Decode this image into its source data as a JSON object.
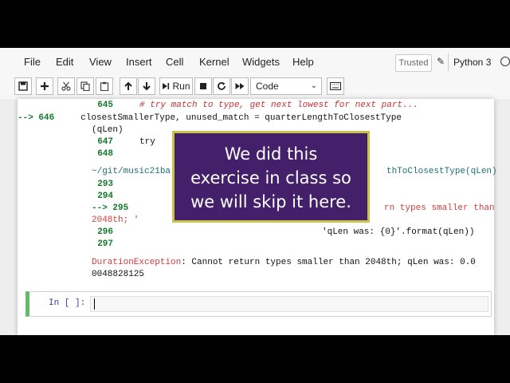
{
  "menu": {
    "items": [
      "File",
      "Edit",
      "View",
      "Insert",
      "Cell",
      "Kernel",
      "Widgets",
      "Help"
    ],
    "trusted": "Trusted",
    "kernel_name": "Python 3"
  },
  "toolbar": {
    "run_label": "Run",
    "cell_type": "Code"
  },
  "traceback": [
    {
      "num": "645",
      "marker": "",
      "code": "# try match to type, get next lowest for next part..."
    },
    {
      "num": "646",
      "marker": "-->",
      "code": "closestSmallerType, unused_match = quarterLengthToClosestType"
    },
    {
      "cont": "(qLen)"
    },
    {
      "num": "647",
      "marker": "",
      "code": "try"
    },
    {
      "num": "648",
      "marker": "",
      "code": ""
    },
    {
      "path": "~/git/music21ba",
      "tail": "thToClosestType(qLen)"
    },
    {
      "num": "293",
      "marker": "",
      "code": ""
    },
    {
      "num": "294",
      "marker": "",
      "code": ""
    },
    {
      "num": "295",
      "marker": "-->",
      "code": "rn types smaller than"
    },
    {
      "cont": "2048th; '"
    },
    {
      "num": "296",
      "marker": "",
      "code": "'qLen was: {0}'.format(qLen))"
    },
    {
      "num": "297",
      "marker": "",
      "code": ""
    }
  ],
  "error": {
    "type": "DurationException",
    "message": ": Cannot return types smaller than 2048th; qLen was: 0.0",
    "message_cont": "0048828125"
  },
  "input_cell": {
    "prompt": "In [ ]:"
  },
  "overlay": {
    "lines": [
      "We did this",
      "exercise in class so",
      "we will skip it here."
    ]
  }
}
